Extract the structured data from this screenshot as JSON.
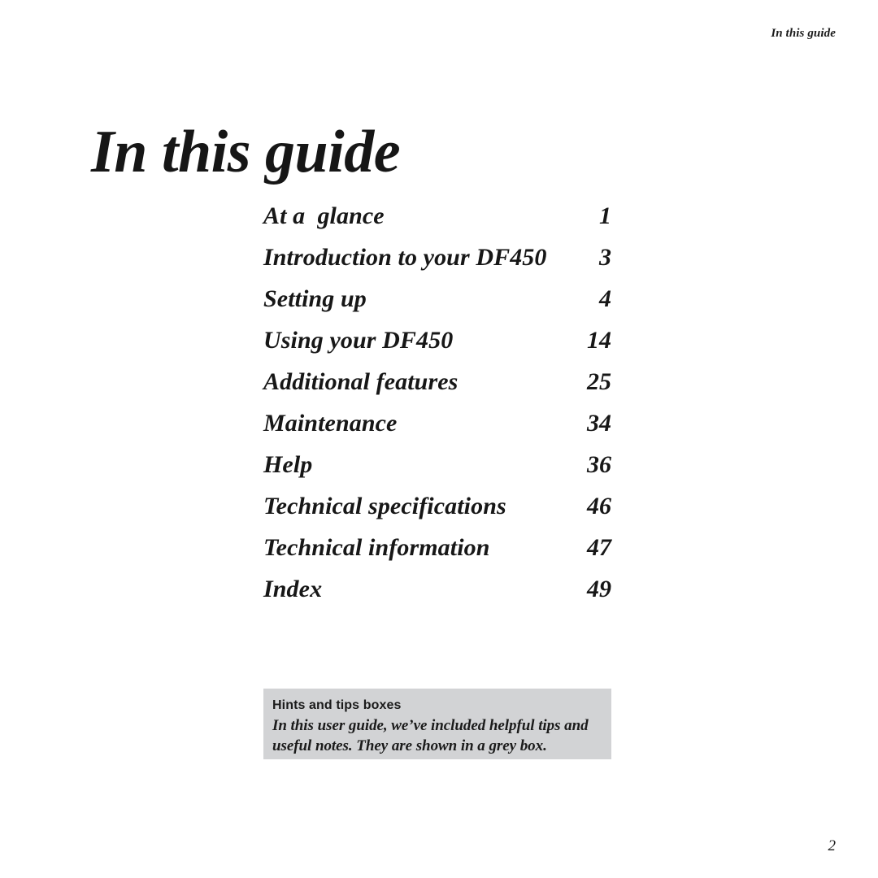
{
  "document": {
    "running_header": "In this guide",
    "title": "In this guide",
    "folio": "2"
  },
  "toc": {
    "entries": [
      {
        "label": "At a  glance",
        "page": "1"
      },
      {
        "label": "Introduction to your DF450",
        "page": "3"
      },
      {
        "label": "Setting up",
        "page": "4"
      },
      {
        "label": "Using your DF450",
        "page": "14"
      },
      {
        "label": "Additional features",
        "page": "25"
      },
      {
        "label": "Maintenance",
        "page": "34"
      },
      {
        "label": "Help",
        "page": "36"
      },
      {
        "label": "Technical specifications",
        "page": "46"
      },
      {
        "label": "Technical information",
        "page": "47"
      },
      {
        "label": "Index",
        "page": "49"
      }
    ]
  },
  "hints_box": {
    "heading": "Hints and tips boxes",
    "body": "In this user guide, we’ve included helpful tips and useful notes. They are shown in a grey box.",
    "background_color": "#d2d3d5"
  },
  "colors": {
    "page_background": "#ffffff",
    "text": "#1a1a1a",
    "grey_box": "#d2d3d5"
  }
}
